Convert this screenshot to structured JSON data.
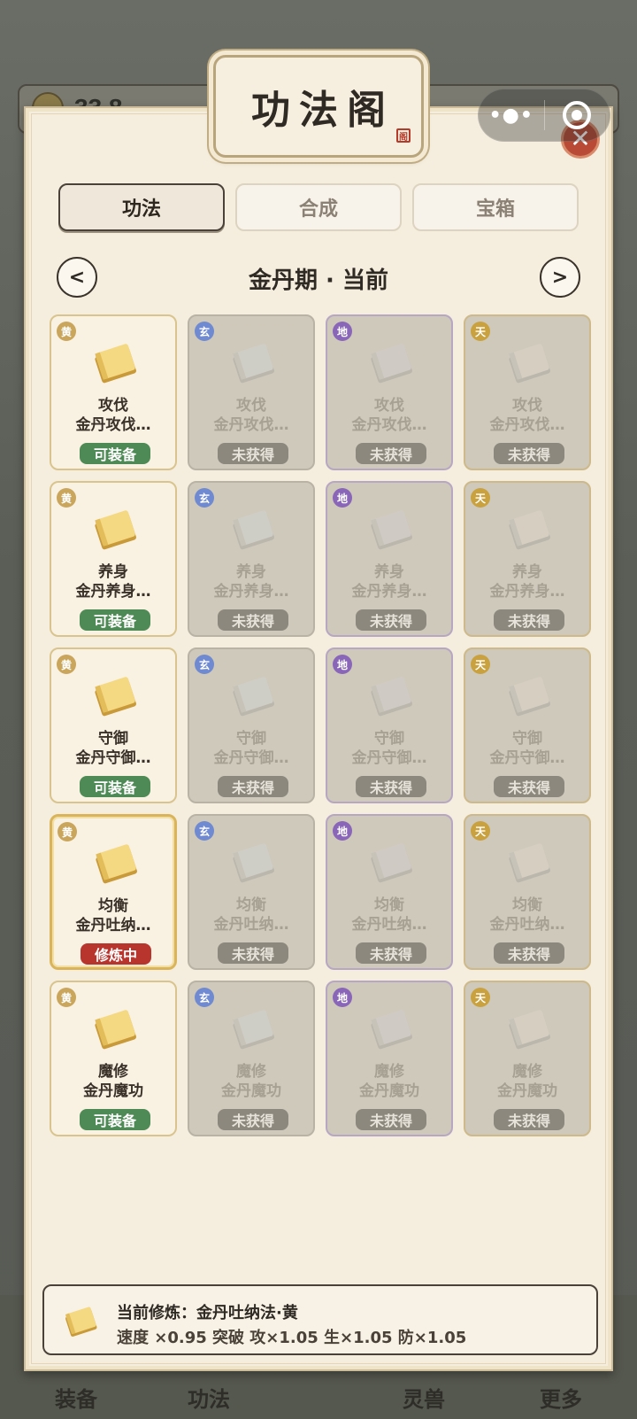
{
  "background": {
    "coin_value": "33.8",
    "nav": [
      "装备",
      "功法",
      "灵兽",
      "更多"
    ]
  },
  "capsule": {
    "dots": "•●•"
  },
  "panel": {
    "title": "功法阁",
    "seal": "阁",
    "close": "✕"
  },
  "tabs": [
    {
      "label": "功法",
      "active": true
    },
    {
      "label": "合成",
      "active": false
    },
    {
      "label": "宝箱",
      "active": false
    }
  ],
  "period": {
    "prev": "<",
    "label": "金丹期 · 当前",
    "next": ">"
  },
  "grades": [
    "黄",
    "玄",
    "地",
    "天"
  ],
  "rows": [
    {
      "name": "攻伐",
      "sub": "金丹攻伐…",
      "status": [
        "可装备",
        "未获得",
        "未获得",
        "未获得"
      ]
    },
    {
      "name": "养身",
      "sub": "金丹养身…",
      "status": [
        "可装备",
        "未获得",
        "未获得",
        "未获得"
      ]
    },
    {
      "name": "守御",
      "sub": "金丹守御…",
      "status": [
        "可装备",
        "未获得",
        "未获得",
        "未获得"
      ]
    },
    {
      "name": "均衡",
      "sub": "金丹吐纳…",
      "status": [
        "修炼中",
        "未获得",
        "未获得",
        "未获得"
      ]
    },
    {
      "name": "魔修",
      "sub": "金丹魔功",
      "status": [
        "可装备",
        "未获得",
        "未获得",
        "未获得"
      ]
    }
  ],
  "current": {
    "line1": "当前修炼：金丹吐纳法·黄",
    "line2": "速度 ×0.95   突破 攻×1.05 生×1.05 防×1.05"
  },
  "colors": {
    "equip": "#4e8a55",
    "training": "#b8352e",
    "locked": "#8d887e",
    "grade_huang": "#c9a65c",
    "grade_xuan": "#6f8ad0",
    "grade_di": "#8a66b8",
    "grade_tian": "#c9a23f"
  },
  "icons": [
    "book-icon",
    "close-icon",
    "chevron-left-icon",
    "chevron-right-icon",
    "menu-dots-icon",
    "target-icon"
  ]
}
